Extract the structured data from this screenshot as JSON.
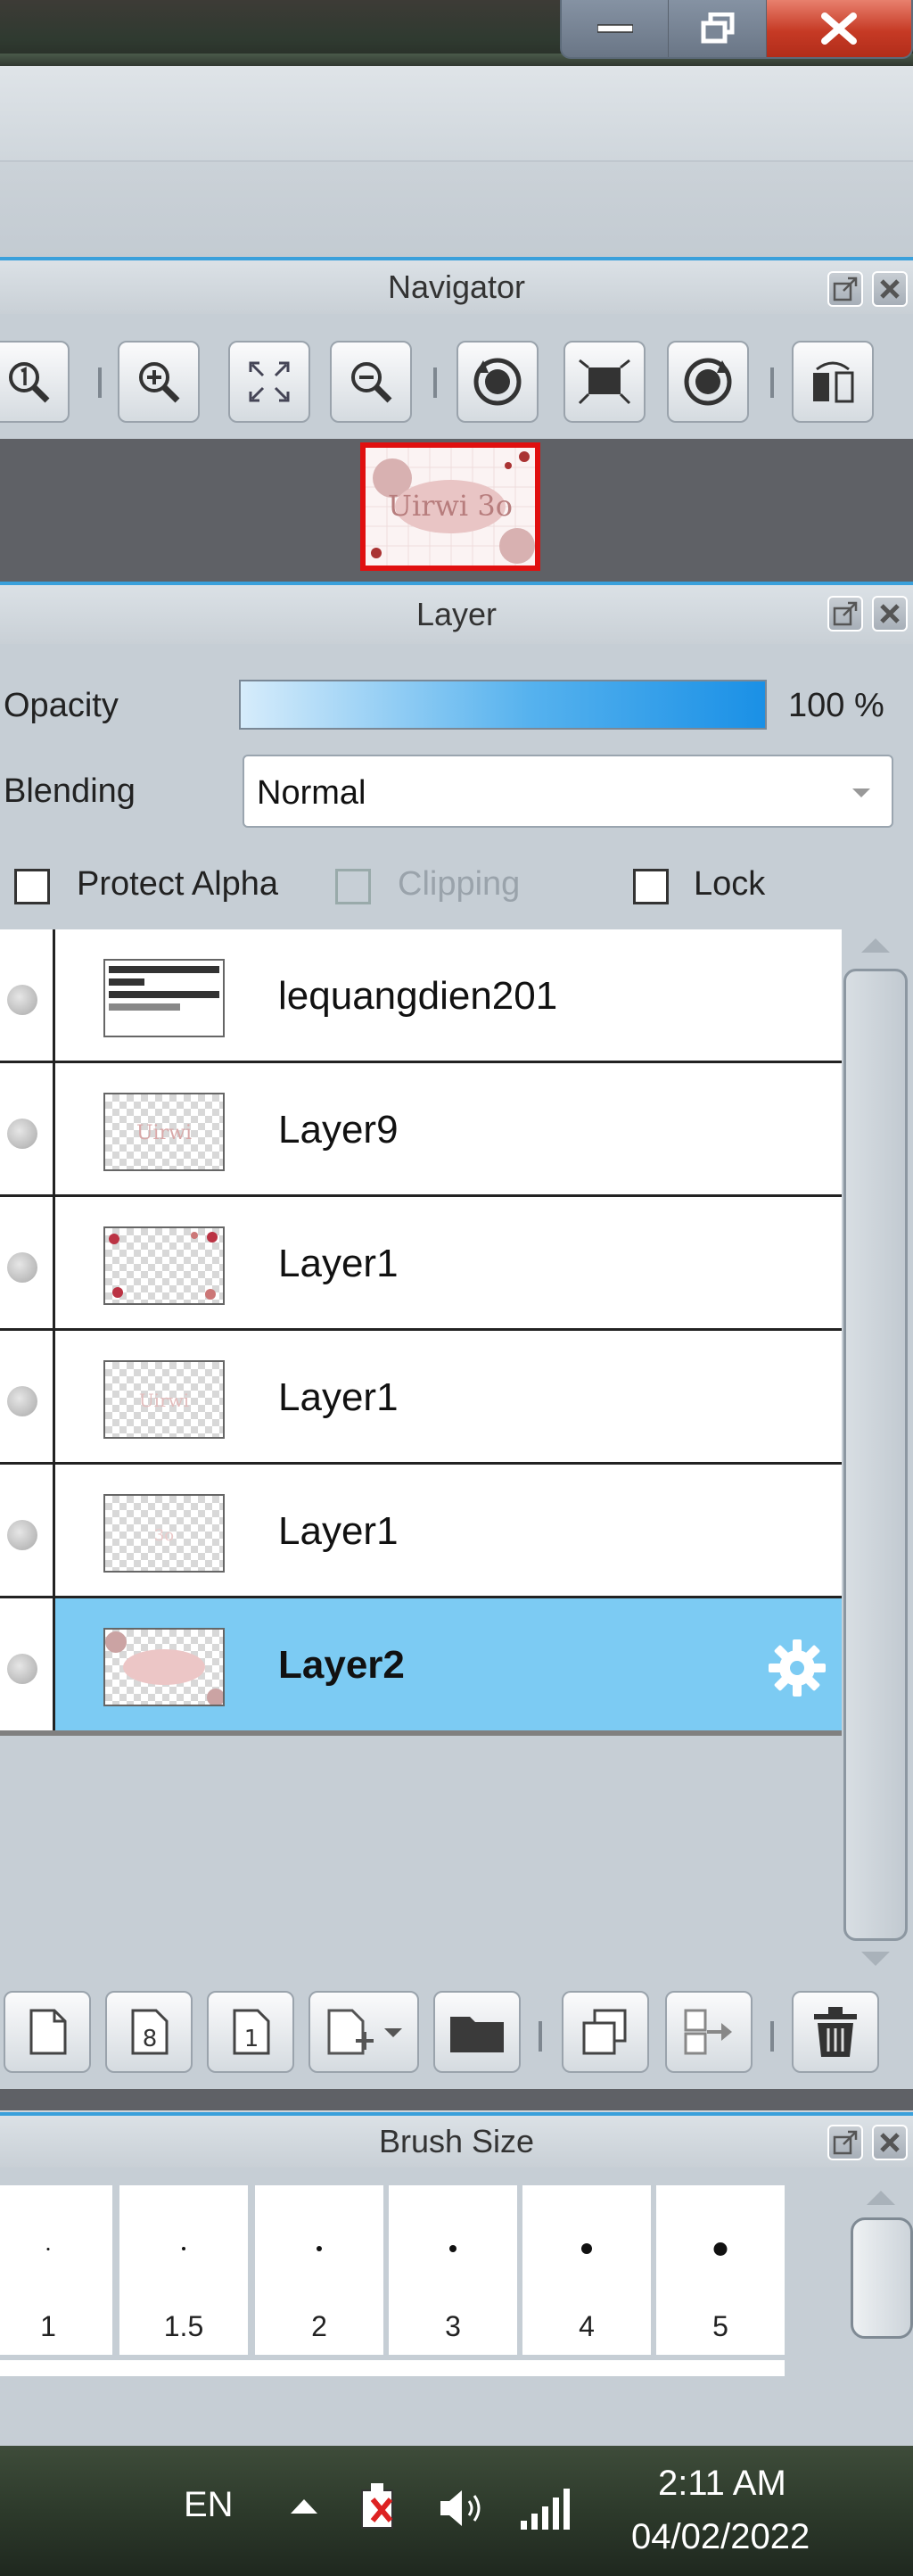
{
  "window": {
    "controls": [
      "minimize",
      "restore",
      "close"
    ]
  },
  "navigator": {
    "title": "Navigator",
    "tools": [
      "zoom-actual-icon",
      "zoom-in-icon",
      "fit-screen-icon",
      "zoom-out-icon",
      "rotate-left-icon",
      "reset-view-icon",
      "rotate-right-icon",
      "flip-icon"
    ],
    "thumbnail_text": "Uirwi 3o"
  },
  "layer": {
    "title": "Layer",
    "opacity_label": "Opacity",
    "opacity_value": "100 %",
    "opacity_fraction": 1.0,
    "blending_label": "Blending",
    "blending_value": "Normal",
    "protect_alpha_label": "Protect Alpha",
    "clipping_label": "Clipping",
    "lock_label": "Lock",
    "layers": [
      {
        "name": "lequangdien201",
        "selected": false
      },
      {
        "name": "Layer9",
        "selected": false
      },
      {
        "name": "Layer1",
        "selected": false
      },
      {
        "name": "Layer1",
        "selected": false
      },
      {
        "name": "Layer1",
        "selected": false
      },
      {
        "name": "Layer2",
        "selected": true
      }
    ],
    "buttons": [
      "new-layer-icon",
      "new-8bit-layer-icon",
      "new-1bit-layer-icon",
      "add-layer-dropdown-icon",
      "new-folder-icon",
      "duplicate-layer-icon",
      "merge-down-icon",
      "delete-layer-icon"
    ]
  },
  "brush_size": {
    "title": "Brush Size",
    "sizes": [
      "1",
      "1.5",
      "2",
      "3",
      "4",
      "5"
    ]
  },
  "taskbar": {
    "language": "EN",
    "time": "2:11 AM",
    "date": "04/02/2022"
  },
  "colors": {
    "accent": "#3aa0db",
    "selected_row": "#7ccbf3",
    "close_red": "#c63a25"
  }
}
